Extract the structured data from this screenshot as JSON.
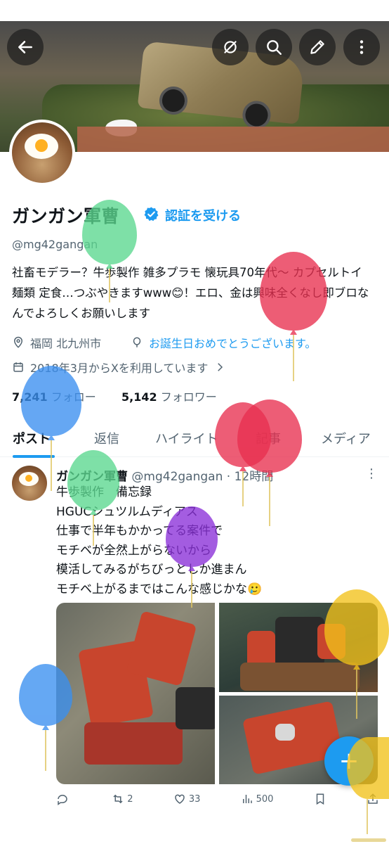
{
  "header": {
    "back_icon": "arrow-left-icon",
    "actions": [
      "no-notifications-icon",
      "search-icon",
      "edit-icon",
      "more-vertical-icon"
    ]
  },
  "profile": {
    "name": "ガンガン軍曹",
    "verify_link": "認証を受ける",
    "handle": "@mg42gangan",
    "bio": "社畜モデラー？牛歩製作 雑多プラモ 懐玩具70年代～ カプセルトイ 麺類 定食…つぶやきますwww😊！エロ、金は興味全くなし即ブロなんでよろしくお願いします",
    "location": "福岡 北九州市",
    "birthday": "お誕生日おめでとうございます。",
    "joined": "2018年3月からXを利用しています",
    "following_count": "7,241",
    "following_label": "フォロー",
    "followers_count": "5,142",
    "followers_label": "フォロワー"
  },
  "tabs": [
    {
      "label": "ポスト",
      "active": true
    },
    {
      "label": "返信",
      "active": false
    },
    {
      "label": "ハイライト",
      "active": false
    },
    {
      "label": "記事",
      "active": false
    },
    {
      "label": "メディア",
      "active": false
    }
  ],
  "post": {
    "author": "ガンガン軍曹",
    "handle_time": "@mg42gangan · 12時間",
    "text": "牛歩製作　備忘録\nHGUCシュツルムディアス\n仕事で半年もかかってる案件で\nモチベが全然上がらないから\n模活してみるがちびっとしか進まん\nモチベ上がるまではこんな感じかな🥲",
    "actions": {
      "reply": "",
      "repost": "2",
      "likes": "33",
      "views": "500"
    }
  },
  "fab_label": "+",
  "colors": {
    "accent": "#1d9bf0",
    "text": "#0f1419",
    "secondary": "#536471",
    "balloon_green": "#5bd88f",
    "balloon_red": "#e8304f",
    "balloon_blue": "#3a8ff0",
    "balloon_purple": "#8a2fd8",
    "balloon_yellow": "#f2c21a"
  }
}
